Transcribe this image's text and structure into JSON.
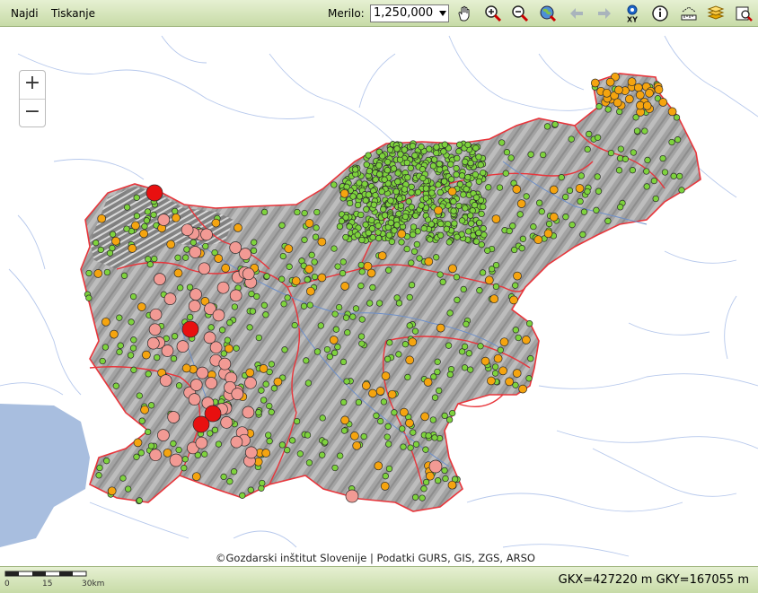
{
  "menu": {
    "find": "Najdi",
    "print": "Tiskanje"
  },
  "scale": {
    "label": "Merilo:",
    "value": "1,250,000"
  },
  "tools": [
    {
      "name": "pan-hand-icon"
    },
    {
      "name": "zoom-in-icon"
    },
    {
      "name": "zoom-out-icon"
    },
    {
      "name": "full-extent-globe-icon"
    },
    {
      "name": "previous-view-arrow-icon"
    },
    {
      "name": "next-view-arrow-icon"
    },
    {
      "name": "xy-coordinate-icon",
      "text": "XY"
    },
    {
      "name": "info-icon"
    },
    {
      "name": "measure-ruler-icon"
    },
    {
      "name": "layers-icon"
    },
    {
      "name": "print-preview-icon"
    }
  ],
  "zoom_control": {
    "plus": "+",
    "minus": "−"
  },
  "attribution": "©Gozdarski inštitut Slovenije | Podatki GURS, GIS, ZGS, ARSO",
  "scalebar": {
    "ticks": [
      "0",
      "15",
      "30km"
    ]
  },
  "coordinates": "GKX=427220 m GKY=167055 m",
  "colors": {
    "green_point": "#7ed33d",
    "orange_point": "#f5a40f",
    "pink_point": "#f29a94",
    "red_point": "#e81010",
    "border": "#e8353b",
    "terrain": "#9c9c9c"
  }
}
